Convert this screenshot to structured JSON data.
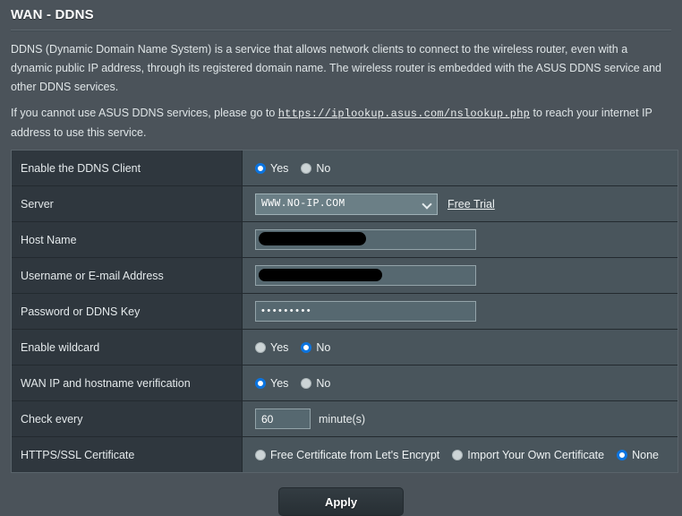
{
  "header": {
    "title": "WAN - DDNS"
  },
  "description": {
    "paragraph1": "DDNS (Dynamic Domain Name System) is a service that allows network clients to connect to the wireless router, even with a dynamic public IP address, through its registered domain name. The wireless router is embedded with the ASUS DDNS service and other DDNS services.",
    "paragraph2_before": "If you cannot use ASUS DDNS services, please go to ",
    "link_text": "https://iplookup.asus.com/nslookup.php",
    "paragraph2_after": " to reach your internet IP address to use this service."
  },
  "form": {
    "rows": {
      "enable_client": {
        "label": "Enable the DDNS Client",
        "options": [
          "Yes",
          "No"
        ],
        "selected": "Yes"
      },
      "server": {
        "label": "Server",
        "value": "WWW.NO-IP.COM",
        "chevron_icon": "chevron-down-icon",
        "free_trial_label": "Free Trial"
      },
      "host_name": {
        "label": "Host Name",
        "value": "",
        "redacted": true
      },
      "username": {
        "label": "Username or E-mail Address",
        "value": "",
        "redacted": true
      },
      "password": {
        "label": "Password or DDNS Key",
        "value": "•••••••••"
      },
      "wildcard": {
        "label": "Enable wildcard",
        "options": [
          "Yes",
          "No"
        ],
        "selected": "No"
      },
      "verification": {
        "label": "WAN IP and hostname verification",
        "options": [
          "Yes",
          "No"
        ],
        "selected": "Yes"
      },
      "check_every": {
        "label": "Check every",
        "value": "60",
        "unit": "minute(s)"
      },
      "https_cert": {
        "label": "HTTPS/SSL Certificate",
        "options": [
          "Free Certificate from Let's Encrypt",
          "Import Your Own Certificate",
          "None"
        ],
        "selected": "None"
      }
    }
  },
  "footer": {
    "apply_label": "Apply"
  },
  "colors": {
    "page_bg": "#4b535a",
    "label_cell_bg": "#2f373e",
    "value_cell_bg": "#49555c",
    "accent_blue": "#0b74e0",
    "input_bg": "#566870",
    "select_bg": "#6b7f86"
  }
}
